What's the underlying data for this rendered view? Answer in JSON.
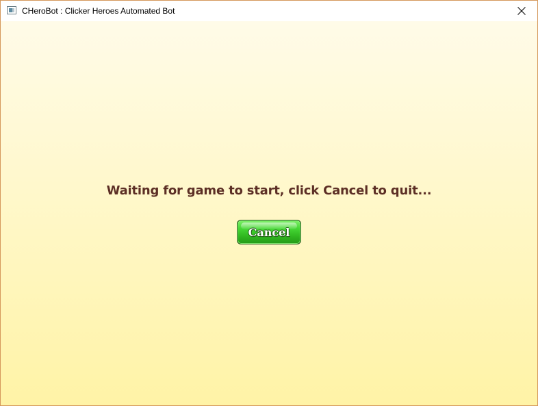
{
  "window": {
    "title": "CHeroBot : Clicker Heroes Automated Bot",
    "icon": "app-window-icon",
    "close_icon": "close-icon"
  },
  "main": {
    "message": "Waiting for game to start, click Cancel to quit...",
    "cancel_label": "Cancel"
  },
  "colors": {
    "background_top": "#fffbe8",
    "background_bottom": "#fff3a6",
    "message_text": "#5c2f25",
    "button_green": "#45d634",
    "window_border": "#d4975a"
  }
}
